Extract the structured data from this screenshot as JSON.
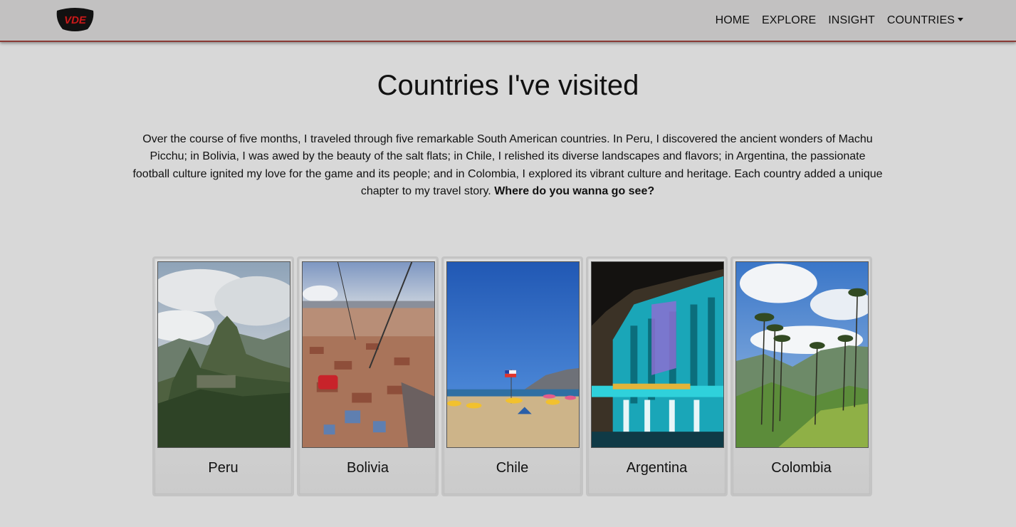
{
  "nav": {
    "logo_text": "VDE",
    "links": [
      {
        "label": "HOME"
      },
      {
        "label": "EXPLORE"
      },
      {
        "label": "INSIGHT"
      },
      {
        "label": "COUNTRIES"
      }
    ]
  },
  "main": {
    "title": "Countries I've visited",
    "intro": "Over the course of five months, I traveled through five remarkable South American countries. In Peru, I discovered the ancient wonders of Machu Picchu; in Bolivia, I was awed by the beauty of the salt flats; in Chile, I relished its diverse landscapes and flavors; in Argentina, the passionate football culture ignited my love for the game and its people; and in Colombia, I explored its vibrant culture and heritage. Each country added a unique chapter to my travel story.",
    "intro_cta": "Where do you wanna go see?"
  },
  "cards": [
    {
      "label": "Peru"
    },
    {
      "label": "Bolivia"
    },
    {
      "label": "Chile"
    },
    {
      "label": "Argentina"
    },
    {
      "label": "Colombia"
    }
  ]
}
